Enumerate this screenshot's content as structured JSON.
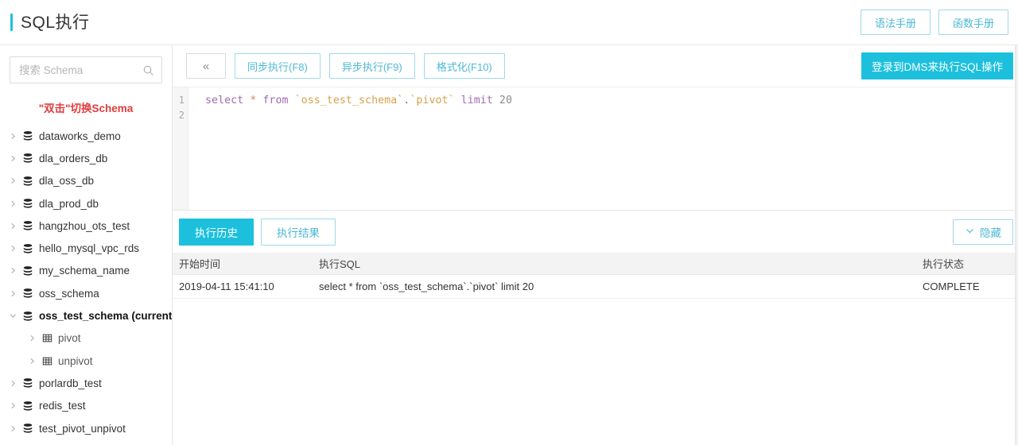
{
  "header": {
    "title": "SQL执行",
    "accent_color": "#1ec0dc",
    "actions": [
      {
        "label": "语法手册",
        "name": "syntax-manual-button"
      },
      {
        "label": "函数手册",
        "name": "function-manual-button"
      }
    ]
  },
  "sidebar": {
    "search": {
      "placeholder": "搜索 Schema",
      "value": "",
      "icon": "search-icon"
    },
    "hint": "\"双击\"切换Schema",
    "hint_color": "#e23b3b",
    "items": [
      {
        "label": "dataworks_demo",
        "icon": "database-icon",
        "expanded": false,
        "level": 0,
        "current": false
      },
      {
        "label": "dla_orders_db",
        "icon": "database-icon",
        "expanded": false,
        "level": 0,
        "current": false
      },
      {
        "label": "dla_oss_db",
        "icon": "database-icon",
        "expanded": false,
        "level": 0,
        "current": false
      },
      {
        "label": "dla_prod_db",
        "icon": "database-icon",
        "expanded": false,
        "level": 0,
        "current": false
      },
      {
        "label": "hangzhou_ots_test",
        "icon": "database-icon",
        "expanded": false,
        "level": 0,
        "current": false
      },
      {
        "label": "hello_mysql_vpc_rds",
        "icon": "database-icon",
        "expanded": false,
        "level": 0,
        "current": false
      },
      {
        "label": "my_schema_name",
        "icon": "database-icon",
        "expanded": false,
        "level": 0,
        "current": false
      },
      {
        "label": "oss_schema",
        "icon": "database-icon",
        "expanded": false,
        "level": 0,
        "current": false
      },
      {
        "label": "oss_test_schema (current)",
        "icon": "database-icon",
        "expanded": true,
        "level": 0,
        "current": true
      },
      {
        "label": "pivot",
        "icon": "table-icon",
        "expanded": false,
        "level": 1,
        "current": false
      },
      {
        "label": "unpivot",
        "icon": "table-icon",
        "expanded": false,
        "level": 1,
        "current": false
      },
      {
        "label": "porlardb_test",
        "icon": "database-icon",
        "expanded": false,
        "level": 0,
        "current": false
      },
      {
        "label": "redis_test",
        "icon": "database-icon",
        "expanded": false,
        "level": 0,
        "current": false
      },
      {
        "label": "test_pivot_unpivot",
        "icon": "database-icon",
        "expanded": false,
        "level": 0,
        "current": false
      }
    ]
  },
  "toolbar": {
    "collapse_label": "«",
    "buttons": [
      {
        "label": "同步执行(F8)",
        "name": "sync-execute-button"
      },
      {
        "label": "异步执行(F9)",
        "name": "async-execute-button"
      },
      {
        "label": "格式化(F10)",
        "name": "format-button"
      }
    ],
    "primary_label": "登录到DMS来执行SQL操作",
    "primary_color": "#1cc0dd"
  },
  "editor": {
    "line_numbers": [
      "1",
      "2"
    ],
    "sql_text": "select * from `oss_test_schema`.`pivot` limit 20",
    "tokens": [
      {
        "text": "select",
        "type": "kw"
      },
      {
        "text": " ",
        "type": "plain"
      },
      {
        "text": "*",
        "type": "op"
      },
      {
        "text": " ",
        "type": "plain"
      },
      {
        "text": "from",
        "type": "kw"
      },
      {
        "text": " ",
        "type": "plain"
      },
      {
        "text": "`oss_test_schema`",
        "type": "id"
      },
      {
        "text": ".",
        "type": "punc"
      },
      {
        "text": "`pivot`",
        "type": "id"
      },
      {
        "text": " ",
        "type": "plain"
      },
      {
        "text": "limit",
        "type": "kw"
      },
      {
        "text": " ",
        "type": "plain"
      },
      {
        "text": "20",
        "type": "num"
      }
    ]
  },
  "results": {
    "tabs": [
      {
        "label": "执行历史",
        "active": true,
        "name": "tab-execution-history"
      },
      {
        "label": "执行结果",
        "active": false,
        "name": "tab-execution-result"
      }
    ],
    "hide_label": "隐藏",
    "hide_icon": "chevron-down-icon",
    "columns": [
      "开始时间",
      "执行SQL",
      "执行状态"
    ],
    "rows": [
      {
        "start_time": "2019-04-11 15:41:10",
        "sql": "select * from `oss_test_schema`.`pivot` limit 20",
        "status": "COMPLETE"
      }
    ]
  }
}
